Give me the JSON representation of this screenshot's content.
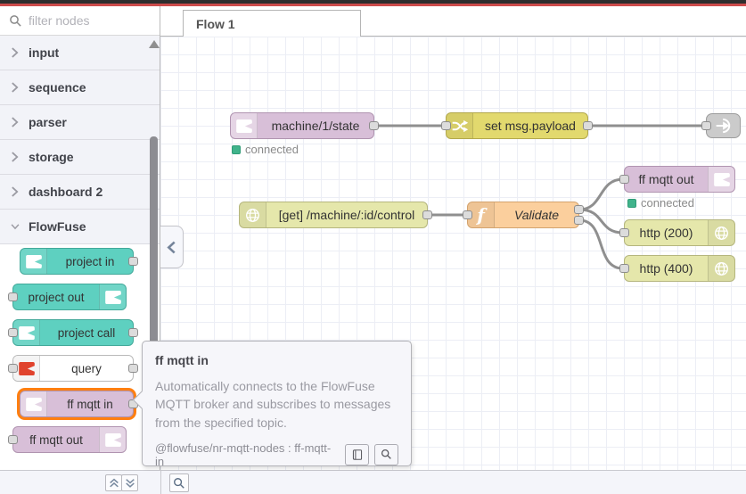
{
  "colors": {
    "header_bar": "#2e2e2e",
    "header_accent": "#cc4b4b",
    "node_project": "#5ed0c0",
    "node_mqtt": "#d8bfd8",
    "node_http": "#e5e7ab",
    "node_change": "#e2d96e",
    "node_function": "#fbcf9d",
    "node_link": "#cbcbcb",
    "query_icon": "#e0432d",
    "hover_highlight": "#ff7f10",
    "status_connected": "#40b38b"
  },
  "icons": {
    "search": "magnifier",
    "category_collapsed": "chevron-right",
    "category_expanded": "chevron-down",
    "palette_toggle": "chevron-left",
    "collapse_all": "double-chevron-up",
    "expand_all": "double-chevron-down",
    "flowfuse_node": "flowfuse-logo",
    "change_node": "shuffle-arrows",
    "http_node": "globe",
    "function_node": "italic-f",
    "link_out_node": "arrow-exit",
    "tooltip_docs": "book",
    "tooltip_search": "magnifier"
  },
  "palette": {
    "filter_placeholder": "filter nodes",
    "categories": [
      {
        "label": "input",
        "expanded": false
      },
      {
        "label": "sequence",
        "expanded": false
      },
      {
        "label": "parser",
        "expanded": false
      },
      {
        "label": "storage",
        "expanded": false
      },
      {
        "label": "dashboard 2",
        "expanded": false
      },
      {
        "label": "FlowFuse",
        "expanded": true
      }
    ],
    "nodes": [
      {
        "label": "project in",
        "type": "project",
        "ports": "out"
      },
      {
        "label": "project out",
        "type": "project",
        "ports": "in"
      },
      {
        "label": "project call",
        "type": "project",
        "ports": "both"
      },
      {
        "label": "query",
        "type": "query",
        "ports": "both"
      },
      {
        "label": "ff mqtt in",
        "type": "mqtt",
        "ports": "out",
        "highlighted": true
      },
      {
        "label": "ff mqtt out",
        "type": "mqtt",
        "ports": "in"
      }
    ]
  },
  "workspace": {
    "tab_label": "Flow 1",
    "nodes": {
      "mqtt_state": {
        "label": "machine/1/state",
        "status": "connected"
      },
      "change": {
        "label": "set msg.payload"
      },
      "http_in": {
        "label": "[get] /machine/:id/control"
      },
      "function": {
        "label": "Validate"
      },
      "mqtt_out": {
        "label": "ff mqtt out",
        "status": "connected"
      },
      "http_200": {
        "label": "http (200)"
      },
      "http_400": {
        "label": "http (400)"
      }
    }
  },
  "tooltip": {
    "title": "ff mqtt in",
    "description": "Automatically connects to the FlowFuse MQTT broker and subscribes to messages from the specified topic.",
    "module": "@flowfuse/nr-mqtt-nodes : ff-mqtt-in"
  }
}
